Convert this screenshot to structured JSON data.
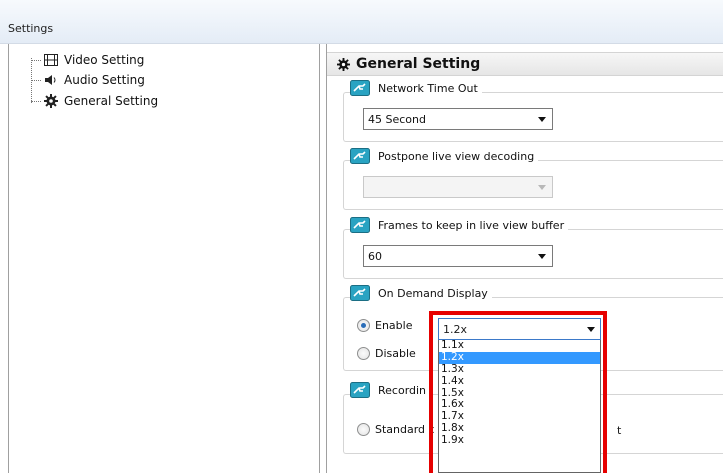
{
  "window": {
    "title": "Settings"
  },
  "tree": {
    "items": [
      {
        "label": "Video Setting",
        "icon": "film-icon"
      },
      {
        "label": "Audio Setting",
        "icon": "speaker-icon"
      },
      {
        "label": "General Setting",
        "icon": "gear-icon"
      }
    ]
  },
  "panel": {
    "header": "General Setting",
    "network_timeout": {
      "label": "Network Time Out",
      "value": "45 Second"
    },
    "postpone": {
      "label": "Postpone live view decoding",
      "value": ""
    },
    "frames": {
      "label": "Frames to keep in live view buffer",
      "value": "60"
    },
    "on_demand": {
      "label": "On Demand Display",
      "enable_label": "Enable",
      "disable_label": "Disable",
      "selected": "enable",
      "value": "1.2x",
      "options": [
        "1.1x",
        "1.2x",
        "1.3x",
        "1.4x",
        "1.5x",
        "1.6x",
        "1.7x",
        "1.8x",
        "1.9x"
      ],
      "highlighted_option": "1.2x"
    },
    "recording": {
      "label": "Recordin",
      "standard_label": "Standard c",
      "trailing_text": "t"
    }
  },
  "colors": {
    "highlight": "#e60000",
    "selection": "#3399ff"
  }
}
